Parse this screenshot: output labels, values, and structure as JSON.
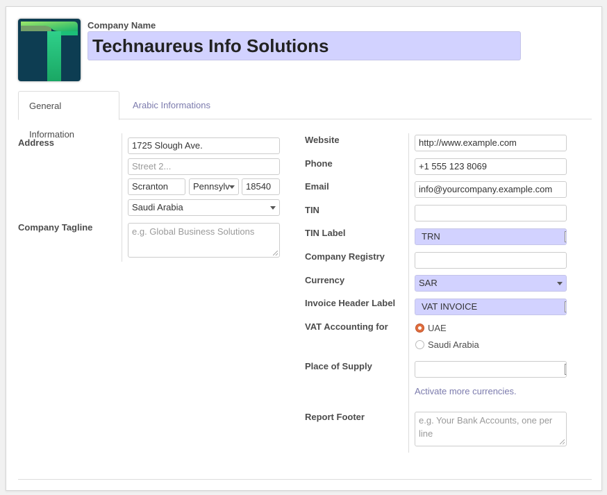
{
  "company": {
    "label": "Company Name",
    "name": "Technaureus Info Solutions"
  },
  "tabs": [
    {
      "label": "General Information",
      "active": true
    },
    {
      "label": "Arabic Informations",
      "active": false
    }
  ],
  "left": {
    "address_label": "Address",
    "street": "1725 Slough Ave.",
    "street2_placeholder": "Street 2...",
    "city": "Scranton",
    "state": "Pennsylv",
    "zip": "18540",
    "country": "Saudi Arabia",
    "tagline_label": "Company Tagline",
    "tagline_placeholder": "e.g. Global Business Solutions"
  },
  "right": {
    "website_label": "Website",
    "website": "http://www.example.com",
    "phone_label": "Phone",
    "phone": "+1 555 123 8069",
    "email_label": "Email",
    "email": "info@yourcompany.example.com",
    "tin_label": "TIN",
    "tin": "",
    "tin_label_label": "TIN Label",
    "tin_label_value": "TRN",
    "registry_label": "Company Registry",
    "registry": "",
    "currency_label": "Currency",
    "currency": "SAR",
    "invoice_header_label": "Invoice Header Label",
    "invoice_header": "VAT INVOICE",
    "vat_label": "VAT Accounting for",
    "vat_options": [
      {
        "label": "UAE",
        "selected": true
      },
      {
        "label": "Saudi Arabia",
        "selected": false
      }
    ],
    "supply_label": "Place of Supply",
    "supply": "",
    "activate_link": "Activate more currencies.",
    "footer_label": "Report Footer",
    "footer_placeholder": "e.g. Your Bank Accounts, one per line"
  },
  "colors": {
    "required_bg": "#d2d2ff",
    "link": "#7c7bad",
    "radio_selected": "#e06f3e"
  },
  "icons": [
    "company-logo",
    "chevron-down-icon",
    "resize-handle-icon"
  ]
}
